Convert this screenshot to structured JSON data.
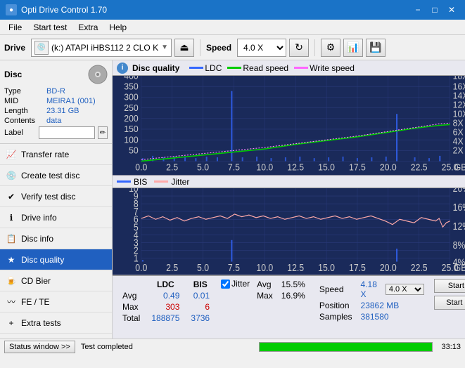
{
  "app": {
    "title": "Opti Drive Control 1.70",
    "icon": "●"
  },
  "titlebar": {
    "title": "Opti Drive Control 1.70",
    "minimize": "−",
    "maximize": "□",
    "close": "✕"
  },
  "menubar": {
    "items": [
      "File",
      "Start test",
      "Extra",
      "Help"
    ]
  },
  "toolbar": {
    "drive_label": "Drive",
    "drive_value": "(k:)  ATAPI iHBS112  2 CLO K",
    "speed_label": "Speed",
    "speed_value": "4.0 X"
  },
  "disc": {
    "section_title": "Disc",
    "type_label": "Type",
    "type_value": "BD-R",
    "mid_label": "MID",
    "mid_value": "MEIRA1 (001)",
    "length_label": "Length",
    "length_value": "23.31 GB",
    "contents_label": "Contents",
    "contents_value": "data",
    "label_label": "Label",
    "label_placeholder": ""
  },
  "sidebar_menu": [
    {
      "id": "transfer-rate",
      "label": "Transfer rate",
      "icon": "📈"
    },
    {
      "id": "create-test-disc",
      "label": "Create test disc",
      "icon": "💿"
    },
    {
      "id": "verify-test-disc",
      "label": "Verify test disc",
      "icon": "✔"
    },
    {
      "id": "drive-info",
      "label": "Drive info",
      "icon": "ℹ"
    },
    {
      "id": "disc-info",
      "label": "Disc info",
      "icon": "📋"
    },
    {
      "id": "disc-quality",
      "label": "Disc quality",
      "icon": "★",
      "active": true
    },
    {
      "id": "cd-bier",
      "label": "CD Bier",
      "icon": "🍺"
    },
    {
      "id": "fe-te",
      "label": "FE / TE",
      "icon": "〰"
    },
    {
      "id": "extra-tests",
      "label": "Extra tests",
      "icon": "+"
    }
  ],
  "disc_quality": {
    "title": "Disc quality",
    "legend": {
      "ldc_label": "LDC",
      "read_speed_label": "Read speed",
      "write_speed_label": "Write speed",
      "bis_label": "BIS",
      "jitter_label": "Jitter"
    },
    "chart1": {
      "y_max": 400,
      "y_right_max": 18,
      "x_max": 25,
      "x_label": "GB",
      "y_ticks": [
        400,
        350,
        300,
        250,
        200,
        150,
        100,
        50
      ],
      "y_right_ticks": [
        18,
        16,
        14,
        12,
        10,
        8,
        6,
        4,
        2
      ],
      "x_ticks": [
        0.0,
        2.5,
        5.0,
        7.5,
        10.0,
        12.5,
        15.0,
        17.5,
        20.0,
        22.5,
        25.0
      ]
    },
    "chart2": {
      "y_max": 10,
      "y_right_max": 20,
      "x_max": 25,
      "x_label": "GB",
      "y_ticks": [
        10,
        9,
        8,
        7,
        6,
        5,
        4,
        3,
        2,
        1
      ],
      "y_right_ticks": [
        20,
        16,
        12,
        8,
        4
      ],
      "x_ticks": [
        0.0,
        2.5,
        5.0,
        7.5,
        10.0,
        12.5,
        15.0,
        17.5,
        20.0,
        22.5,
        25.0
      ]
    }
  },
  "stats": {
    "col_ldc": "LDC",
    "col_bis": "BIS",
    "row_avg": "Avg",
    "row_max": "Max",
    "row_total": "Total",
    "ldc_avg": "0.49",
    "ldc_max": "303",
    "ldc_total": "188875",
    "bis_avg": "0.01",
    "bis_max": "6",
    "bis_total": "3736",
    "jitter_label": "Jitter",
    "jitter_avg": "15.5%",
    "jitter_max": "16.9%",
    "speed_label": "Speed",
    "speed_value": "4.18 X",
    "speed_select": "4.0 X",
    "position_label": "Position",
    "position_value": "23862 MB",
    "samples_label": "Samples",
    "samples_value": "381580",
    "start_full": "Start full",
    "start_part": "Start part"
  },
  "statusbar": {
    "status_btn": "Status window >>",
    "status_text": "Test completed",
    "progress": 100,
    "time": "33:13"
  },
  "colors": {
    "ldc": "#3366ff",
    "read_speed": "#00cc00",
    "write_speed": "#ff66ff",
    "bis": "#3366ff",
    "jitter": "#ffaaaa",
    "background_chart": "#1a2a5a",
    "grid": "#2a3a6a",
    "accent": "#2060c0"
  }
}
